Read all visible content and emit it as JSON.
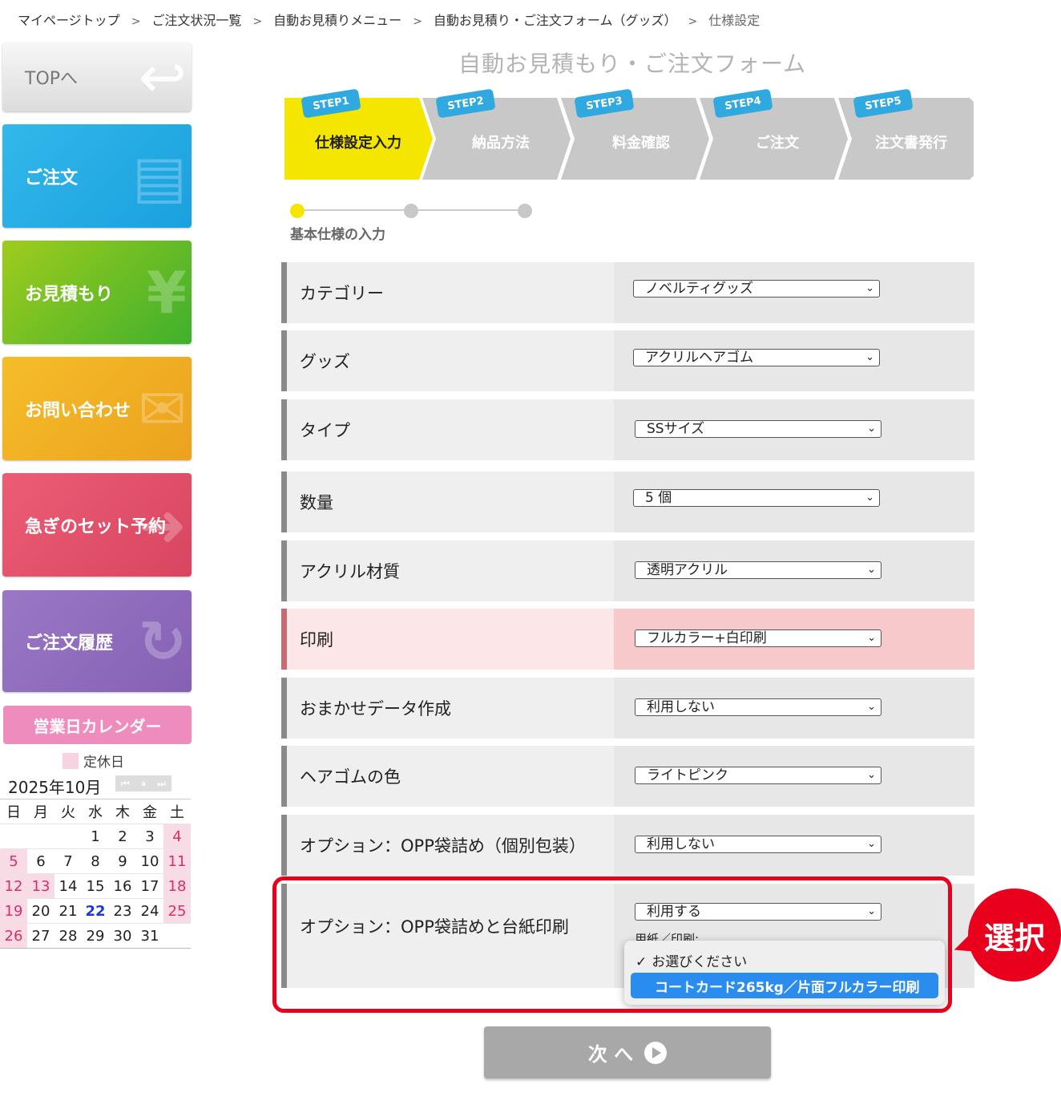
{
  "breadcrumb": [
    {
      "label": "マイページトップ"
    },
    {
      "label": "ご注文状況一覧"
    },
    {
      "label": "自動お見積りメニュー"
    },
    {
      "label": "自動お見積り・ご注文フォーム（グッズ）"
    },
    {
      "label": "仕様設定"
    }
  ],
  "breadcrumb_sep": ">",
  "sidebar": {
    "top": "TOPへ",
    "order": "ご注文",
    "estimate": "お見積もり",
    "inquiry": "お問い合わせ",
    "rush": "急ぎのセット予約",
    "history": "ご注文履歴"
  },
  "calendar": {
    "title": "営業日カレンダー",
    "legend": "定休日",
    "month": "2025年10月",
    "weekdays": [
      "日",
      "月",
      "火",
      "水",
      "木",
      "金",
      "土"
    ],
    "weeks": [
      [
        "",
        "",
        "",
        "1",
        "2",
        "3",
        "4"
      ],
      [
        "5",
        "6",
        "7",
        "8",
        "9",
        "10",
        "11"
      ],
      [
        "12",
        "13",
        "14",
        "15",
        "16",
        "17",
        "18"
      ],
      [
        "19",
        "20",
        "21",
        "22",
        "23",
        "24",
        "25"
      ],
      [
        "26",
        "27",
        "28",
        "29",
        "30",
        "31",
        ""
      ]
    ],
    "holiday_color": "#f9dbe6",
    "today": "22"
  },
  "main": {
    "title": "自動お見積もり・ご注文フォーム",
    "steps": [
      {
        "tag": "STEP1",
        "label": "仕様設定入力",
        "active": true
      },
      {
        "tag": "STEP2",
        "label": "納品方法",
        "active": false
      },
      {
        "tag": "STEP3",
        "label": "料金確認",
        "active": false
      },
      {
        "tag": "STEP4",
        "label": "ご注文",
        "active": false
      },
      {
        "tag": "STEP5",
        "label": "注文書発行",
        "active": false
      }
    ],
    "progress_label": "基本仕様の入力",
    "progress_step": 1,
    "progress_total": 3,
    "rows": [
      {
        "label": "カテゴリー",
        "value": "ノベルティグッズ"
      },
      {
        "label": "グッズ",
        "value": "アクリルヘアゴム"
      },
      {
        "label": "タイプ",
        "value": "SSサイズ"
      },
      {
        "label": "数量",
        "value": "5 個"
      },
      {
        "label": "アクリル材質",
        "value": "透明アクリル"
      },
      {
        "label": "印刷",
        "value": "フルカラー+白印刷"
      },
      {
        "label": "おまかせデータ作成",
        "value": "利用しない"
      },
      {
        "label": "ヘアゴムの色",
        "value": "ライトピンク"
      },
      {
        "label": "オプション：OPP袋詰め（個別包装）",
        "value": "利用しない"
      },
      {
        "label": "オプション：OPP袋詰めと台紙印刷",
        "value": "利用する",
        "sub": "用紙／印刷:"
      }
    ],
    "dropdown": {
      "options": [
        "お選びください",
        "コートカード265kg／片面フルカラー印刷"
      ],
      "checkmark": "✓"
    },
    "badge": "選択",
    "next": "次 へ"
  },
  "colors": {
    "accent_yellow": "#f5e600",
    "step_tag": "#2fa9df",
    "highlight_red": "#e8001c",
    "selected_blue": "#2b8cf0"
  }
}
